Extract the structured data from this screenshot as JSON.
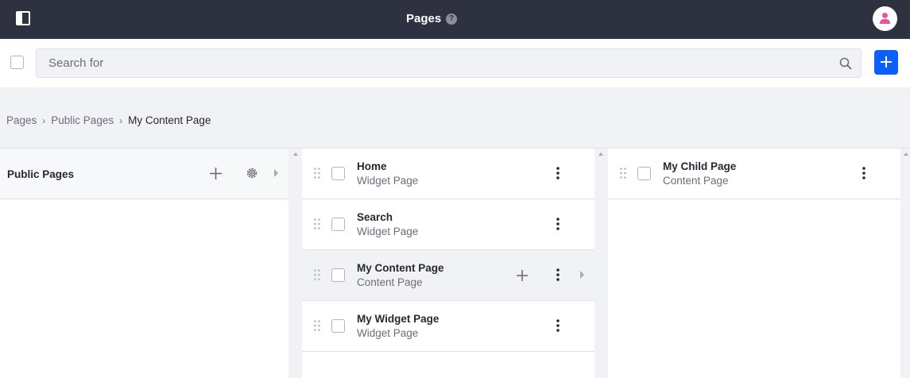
{
  "header": {
    "title": "Pages",
    "help": "?"
  },
  "toolbar": {
    "search_placeholder": "Search for"
  },
  "breadcrumb": [
    "Pages",
    "Public Pages",
    "My Content Page"
  ],
  "columns": {
    "first": {
      "header": "Public Pages"
    },
    "second": {
      "rows": [
        {
          "title": "Home",
          "subtitle": "Widget Page"
        },
        {
          "title": "Search",
          "subtitle": "Widget Page"
        },
        {
          "title": "My Content Page",
          "subtitle": "Content Page"
        },
        {
          "title": "My Widget Page",
          "subtitle": "Widget Page"
        }
      ]
    },
    "third": {
      "rows": [
        {
          "title": "My Child Page",
          "subtitle": "Content Page"
        }
      ]
    }
  },
  "colors": {
    "header_bg": "#2e313f",
    "primary": "#0b5fff",
    "avatar_accent": "#e9559b"
  }
}
